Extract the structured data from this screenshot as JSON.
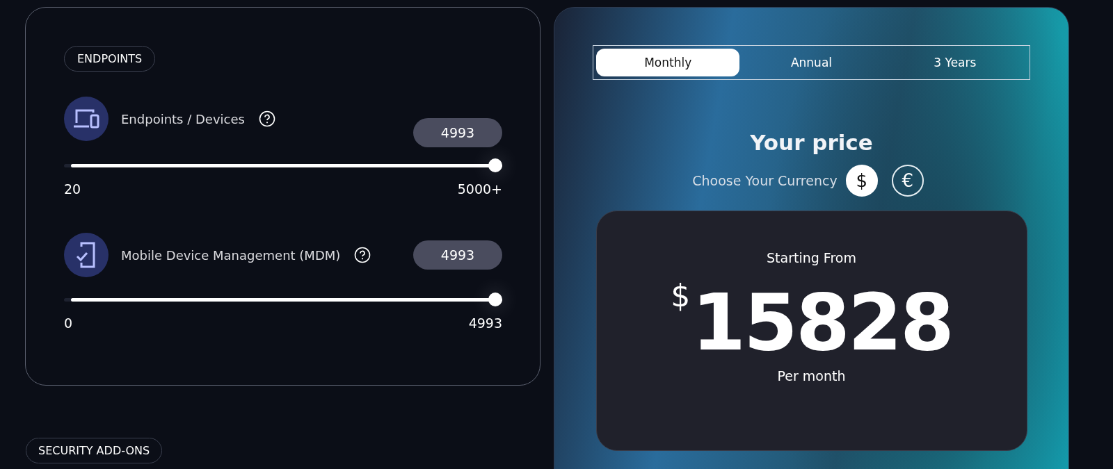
{
  "endpoints_section": {
    "title": "ENDPOINTS",
    "sliders": [
      {
        "kind": "laptop",
        "label": "Endpoints / Devices",
        "value": "4993",
        "level": 1,
        "min": "20",
        "max": "5000+"
      },
      {
        "kind": "phone",
        "label": "Mobile Device Management (MDM)",
        "value": "4993",
        "level": 1,
        "min": "0",
        "max": "4993"
      }
    ]
  },
  "addons_section": {
    "title": "SECURITY ADD-ONS"
  },
  "pricing": {
    "tabs": [
      {
        "label": "Monthly",
        "selected": true
      },
      {
        "label": "Annual",
        "selected": false
      },
      {
        "label": "3 Years",
        "selected": false
      }
    ],
    "title": "Your price",
    "currency_label": "Choose Your Currency",
    "currencies": [
      {
        "symbol": "$",
        "selected": true
      },
      {
        "symbol": "€",
        "selected": false
      }
    ],
    "starting_label": "Starting From",
    "currency_sign": "$",
    "amount": "15828",
    "period": "Per month"
  }
}
